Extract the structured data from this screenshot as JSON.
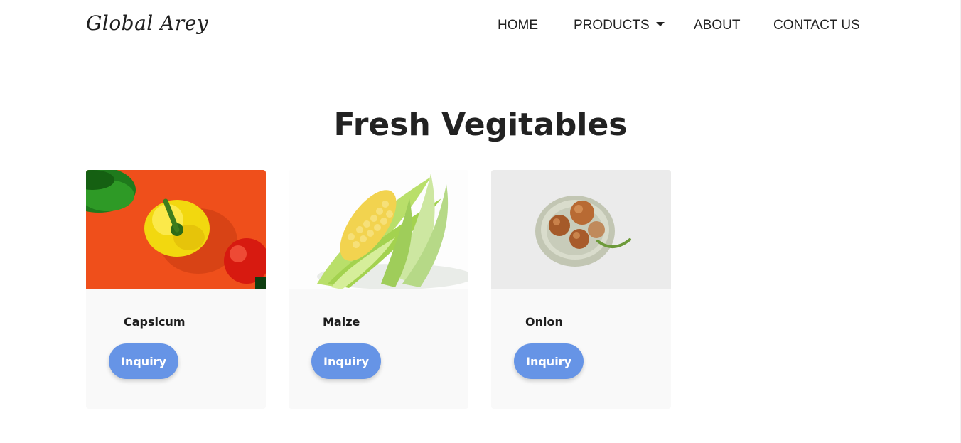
{
  "brand": "Global Arey",
  "nav": {
    "home": "HOME",
    "products": "PRODUCTS",
    "about": "ABOUT",
    "contact": "CONTACT US"
  },
  "section_title": "Fresh Vegitables",
  "products": [
    {
      "name": "Capsicum",
      "button": "Inquiry"
    },
    {
      "name": "Maize",
      "button": "Inquiry"
    },
    {
      "name": "Onion",
      "button": "Inquiry"
    }
  ],
  "colors": {
    "accent": "#6694e6",
    "text": "#222222",
    "card_bg": "#f9f9f9"
  }
}
